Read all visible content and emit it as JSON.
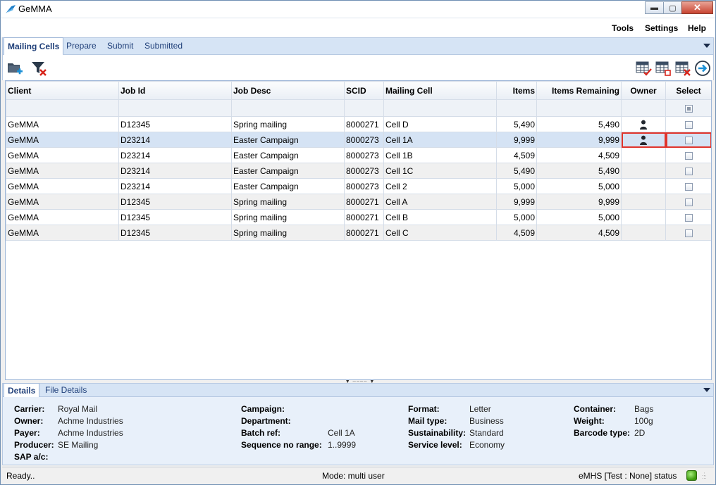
{
  "window": {
    "title": "GeMMA",
    "minimize": "▬",
    "maximize": "▢",
    "close": "✕"
  },
  "menu": {
    "tools": "Tools",
    "settings": "Settings",
    "help": "Help"
  },
  "tabs": [
    {
      "label": "Mailing Cells",
      "active": true
    },
    {
      "label": "Prepare",
      "active": false
    },
    {
      "label": "Submit",
      "active": false
    },
    {
      "label": "Submitted",
      "active": false
    }
  ],
  "toolbar": {
    "left_icons": [
      "folder-add-icon",
      "clear-filter-icon"
    ],
    "right_icons": [
      "grid-check-icon",
      "grid-uncheck-icon",
      "grid-delete-icon",
      "arrow-right-circle-icon"
    ]
  },
  "grid": {
    "columns": [
      {
        "key": "client",
        "label": "Client"
      },
      {
        "key": "job_id",
        "label": "Job Id"
      },
      {
        "key": "job_desc",
        "label": "Job Desc"
      },
      {
        "key": "scid",
        "label": "SCID"
      },
      {
        "key": "mailing_cell",
        "label": "Mailing Cell"
      },
      {
        "key": "items",
        "label": "Items"
      },
      {
        "key": "items_remaining",
        "label": "Items Remaining"
      },
      {
        "key": "owner",
        "label": "Owner"
      },
      {
        "key": "select",
        "label": "Select"
      }
    ],
    "rows": [
      {
        "client": "GeMMA",
        "job_id": "D12345",
        "job_desc": "Spring mailing",
        "scid": "8000271",
        "mailing_cell": "Cell D",
        "items": "5,490",
        "items_remaining": "5,490",
        "owner": true,
        "select": false
      },
      {
        "client": "GeMMA",
        "job_id": "D23214",
        "job_desc": "Easter Campaign",
        "scid": "8000273",
        "mailing_cell": "Cell 1A",
        "items": "9,999",
        "items_remaining": "9,999",
        "owner": true,
        "select": false,
        "selected": true
      },
      {
        "client": "GeMMA",
        "job_id": "D23214",
        "job_desc": "Easter Campaign",
        "scid": "8000273",
        "mailing_cell": "Cell 1B",
        "items": "4,509",
        "items_remaining": "4,509",
        "owner": false,
        "select": false
      },
      {
        "client": "GeMMA",
        "job_id": "D23214",
        "job_desc": "Easter Campaign",
        "scid": "8000273",
        "mailing_cell": "Cell 1C",
        "items": "5,490",
        "items_remaining": "5,490",
        "owner": false,
        "select": false
      },
      {
        "client": "GeMMA",
        "job_id": "D23214",
        "job_desc": "Easter Campaign",
        "scid": "8000273",
        "mailing_cell": "Cell 2",
        "items": "5,000",
        "items_remaining": "5,000",
        "owner": false,
        "select": false
      },
      {
        "client": "GeMMA",
        "job_id": "D12345",
        "job_desc": "Spring mailing",
        "scid": "8000271",
        "mailing_cell": "Cell A",
        "items": "9,999",
        "items_remaining": "9,999",
        "owner": false,
        "select": false
      },
      {
        "client": "GeMMA",
        "job_id": "D12345",
        "job_desc": "Spring mailing",
        "scid": "8000271",
        "mailing_cell": "Cell B",
        "items": "5,000",
        "items_remaining": "5,000",
        "owner": false,
        "select": false
      },
      {
        "client": "GeMMA",
        "job_id": "D12345",
        "job_desc": "Spring mailing",
        "scid": "8000271",
        "mailing_cell": "Cell C",
        "items": "4,509",
        "items_remaining": "4,509",
        "owner": false,
        "select": false
      }
    ]
  },
  "details_tabs": [
    {
      "label": "Details",
      "active": true
    },
    {
      "label": "File Details",
      "active": false
    }
  ],
  "details": {
    "carrier": {
      "label": "Carrier:",
      "value": "Royal Mail"
    },
    "owner": {
      "label": "Owner:",
      "value": "Achme Industries"
    },
    "payer": {
      "label": "Payer:",
      "value": "Achme Industries"
    },
    "producer": {
      "label": "Producer:",
      "value": "SE Mailing"
    },
    "sap": {
      "label": "SAP a/c:",
      "value": ""
    },
    "campaign": {
      "label": "Campaign:",
      "value": ""
    },
    "department": {
      "label": "Department:",
      "value": ""
    },
    "batch_ref": {
      "label": "Batch ref:",
      "value": "Cell 1A"
    },
    "sequence": {
      "label": "Sequence no range:",
      "value": "1..9999"
    },
    "format": {
      "label": "Format:",
      "value": "Letter"
    },
    "mail_type": {
      "label": "Mail type:",
      "value": "Business"
    },
    "sustainability": {
      "label": "Sustainability:",
      "value": "Standard"
    },
    "service_level": {
      "label": "Service level:",
      "value": "Economy"
    },
    "container": {
      "label": "Container:",
      "value": "Bags"
    },
    "weight": {
      "label": "Weight:",
      "value": "100g"
    },
    "barcode_type": {
      "label": "Barcode type:",
      "value": "2D"
    }
  },
  "status": {
    "ready": "Ready..",
    "mode": "Mode: multi user",
    "emhs": "eMHS [Test : None] status",
    "light_color": "#3e9b10"
  },
  "colors": {
    "accent": "#1f3f79",
    "tab_strip": "#d6e4f5",
    "selection": "#d5e3f4",
    "highlight_box": "#e0342c"
  }
}
